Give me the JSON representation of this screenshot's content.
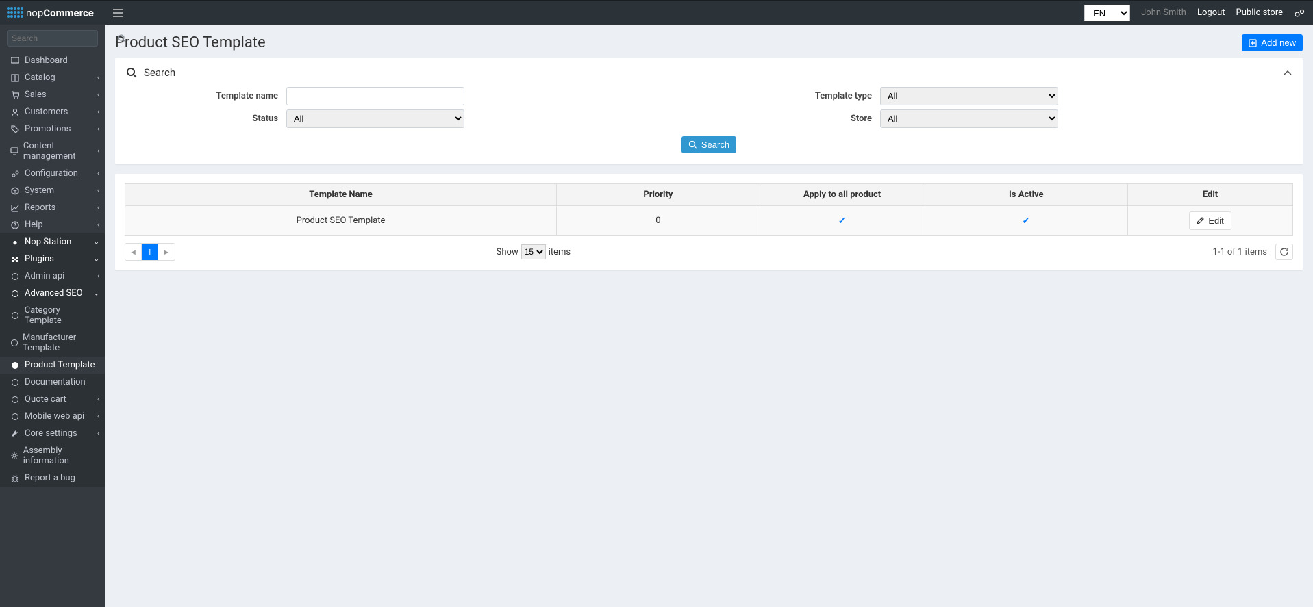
{
  "header": {
    "brand_prefix": "nop",
    "brand_main": "Commerce",
    "language": "EN",
    "user": "John Smith",
    "logout": "Logout",
    "public_store": "Public store"
  },
  "sidebar": {
    "search_placeholder": "Search",
    "items": [
      {
        "label": "Dashboard",
        "icon": "dashboard"
      },
      {
        "label": "Catalog",
        "icon": "cart",
        "expandable": true
      },
      {
        "label": "Sales",
        "icon": "cart2",
        "expandable": true
      },
      {
        "label": "Customers",
        "icon": "user",
        "expandable": true
      },
      {
        "label": "Promotions",
        "icon": "tags",
        "expandable": true
      },
      {
        "label": "Content management",
        "icon": "cms",
        "expandable": true
      },
      {
        "label": "Configuration",
        "icon": "cogs",
        "expandable": true
      },
      {
        "label": "System",
        "icon": "cube",
        "expandable": true
      },
      {
        "label": "Reports",
        "icon": "chart",
        "expandable": true
      },
      {
        "label": "Help",
        "icon": "help",
        "expandable": true
      }
    ],
    "nop_station": {
      "label": "Nop Station",
      "children": [
        {
          "label": "Plugins",
          "expandable": true
        },
        {
          "label": "Admin api",
          "expandable": true
        },
        {
          "label": "Advanced SEO",
          "expandable": true,
          "open": true,
          "children": [
            {
              "label": "Category Template"
            },
            {
              "label": "Manufacturer Template"
            },
            {
              "label": "Product Template",
              "active": true
            },
            {
              "label": "Documentation"
            }
          ]
        },
        {
          "label": "Quote cart",
          "expandable": true
        },
        {
          "label": "Mobile web api",
          "expandable": true
        },
        {
          "label": "Core settings",
          "expandable": true
        },
        {
          "label": "Assembly information"
        },
        {
          "label": "Report a bug"
        }
      ]
    }
  },
  "page": {
    "title": "Product SEO Template",
    "add_new": "Add new",
    "search": {
      "heading": "Search",
      "template_name_label": "Template name",
      "template_type_label": "Template type",
      "status_label": "Status",
      "store_label": "Store",
      "status_value": "All",
      "template_type_value": "All",
      "store_value": "All",
      "button": "Search"
    },
    "grid": {
      "columns": [
        "Template Name",
        "Priority",
        "Apply to all product",
        "Is Active",
        "Edit"
      ],
      "row": {
        "name": "Product SEO Template",
        "priority": "0",
        "apply_all": true,
        "is_active": true,
        "edit_label": "Edit"
      },
      "page_current": "1",
      "show_label": "Show",
      "show_value": "15",
      "items_label": "items",
      "count_text": "1-1 of 1 items"
    }
  }
}
